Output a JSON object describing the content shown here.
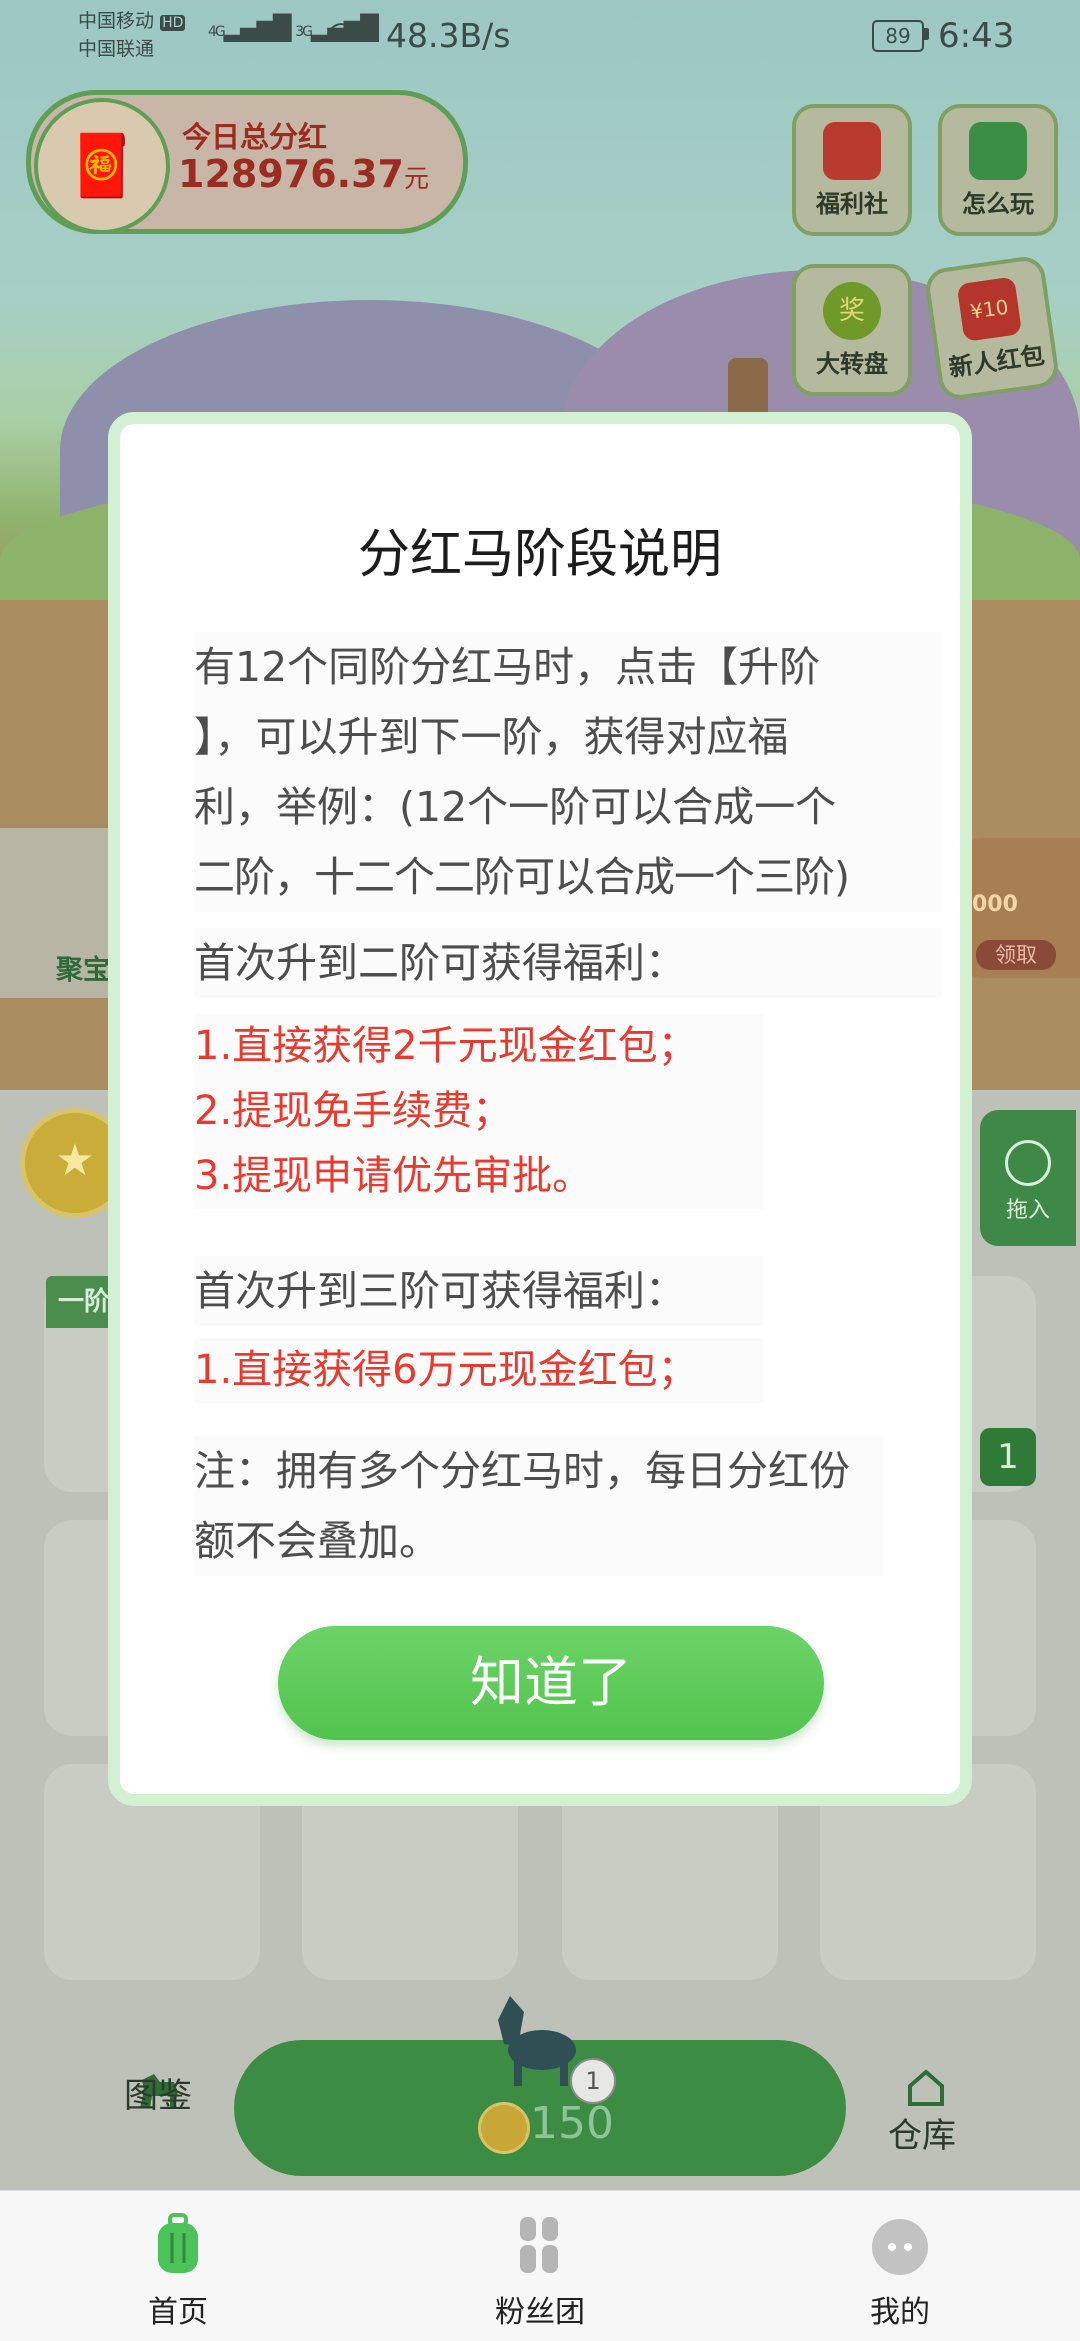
{
  "status_bar": {
    "carrier1": "中国移动",
    "hd": "HD",
    "carrier2": "中国联通",
    "network1": "4G",
    "network2": "3G",
    "speed": "48.3B/s",
    "battery": "89",
    "time": "6:43"
  },
  "header": {
    "dividend_label": "今日总分红",
    "dividend_value": "128976.37",
    "dividend_unit": "元"
  },
  "quick_actions": {
    "welfare": "福利社",
    "how_to_play": "怎么玩",
    "wheel": "大转盘",
    "newbie_redpack": "新人红包",
    "wheel_center": "奖",
    "redpack_amount": "¥10"
  },
  "side": {
    "treasure_label": "聚宝",
    "right_amount": "000",
    "right_button": "领取",
    "recycle_label": "拖入",
    "stage_tag": "一阶",
    "count_badge": "1"
  },
  "bottom_bar": {
    "handbook": "图鉴",
    "buy_price": "150",
    "horse_level": "1",
    "warehouse": "仓库"
  },
  "tabs": [
    {
      "label": "首页",
      "active": true
    },
    {
      "label": "粉丝团",
      "active": false
    },
    {
      "label": "我的",
      "active": false
    }
  ],
  "modal": {
    "title": "分红马阶段说明",
    "intro_lines": [
      "有12个同阶分红马时，点击【升阶",
      "】，可以升到下一阶，获得对应福",
      "利，举例：(12个一阶可以合成一个",
      "二阶，十二个二阶可以合成一个三阶)"
    ],
    "stage2_heading": "首次升到二阶可获得福利：",
    "stage2_benefits": [
      "1.直接获得2千元现金红包；",
      "2.提现免手续费；",
      "3.提现申请优先审批。"
    ],
    "stage3_heading": "首次升到三阶可获得福利：",
    "stage3_benefits": [
      "1.直接获得6万元现金红包；"
    ],
    "note_lines": [
      "注：拥有多个分红马时，每日分红份",
      "额不会叠加。"
    ],
    "confirm_button": "知道了"
  },
  "colors": {
    "accent_green": "#5ccb58",
    "benefit_red": "#e83a2e",
    "overlay_tint": "#7f8a6f"
  }
}
